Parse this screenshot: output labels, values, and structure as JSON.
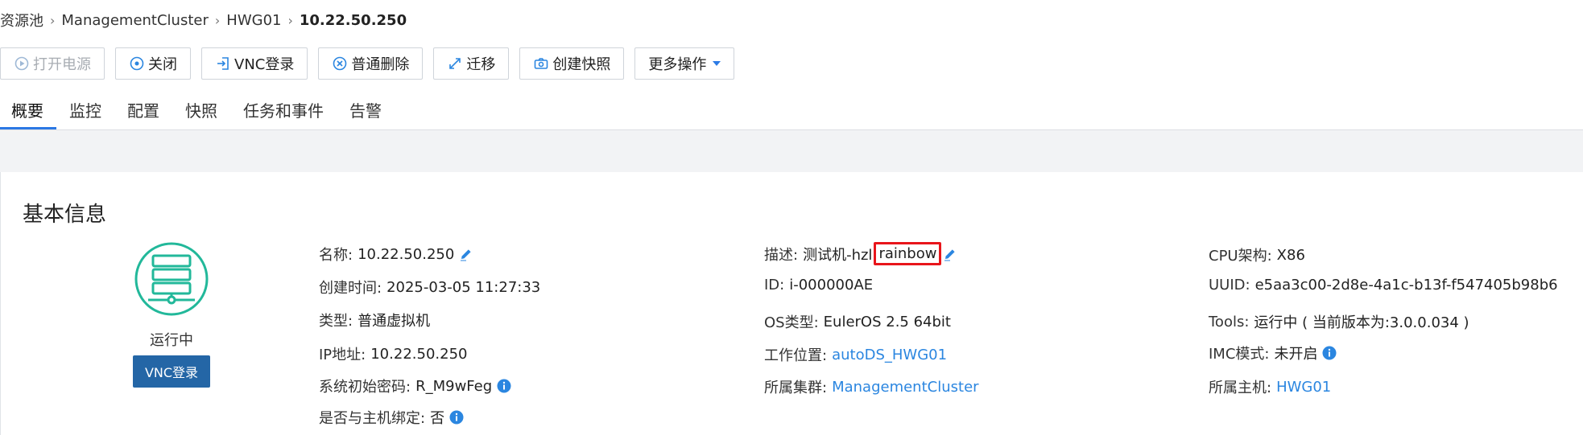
{
  "breadcrumb": {
    "items": [
      "资源池",
      "ManagementCluster",
      "HWG01"
    ],
    "current": "10.22.50.250"
  },
  "toolbar": {
    "power_on": "打开电源",
    "shutdown": "关闭",
    "vnc_login": "VNC登录",
    "delete": "普通删除",
    "migrate": "迁移",
    "snapshot": "创建快照",
    "more": "更多操作"
  },
  "tabs": [
    "概要",
    "监控",
    "配置",
    "快照",
    "任务和事件",
    "告警"
  ],
  "section": {
    "title": "基本信息"
  },
  "vm": {
    "status": "运行中",
    "vnc_button": "VNC登录"
  },
  "col1": {
    "name_label": "名称:",
    "name_value": "10.22.50.250",
    "created_label": "创建时间:",
    "created_value": "2025-03-05 11:27:33",
    "type_label": "类型:",
    "type_value": "普通虚拟机",
    "ip_label": "IP地址:",
    "ip_value": "10.22.50.250",
    "pwd_label": "系统初始密码:",
    "pwd_value": "R_M9wFeg",
    "bind_label": "是否与主机绑定:",
    "bind_value": "否"
  },
  "col2": {
    "desc_label": "描述:",
    "desc_value": "测试机-hzl",
    "desc_highlight": "rainbow",
    "id_label": "ID:",
    "id_value": "i-000000AE",
    "os_label": "OS类型:",
    "os_value": "EulerOS 2.5 64bit",
    "location_label": "工作位置:",
    "location_value": "autoDS_HWG01",
    "cluster_label": "所属集群:",
    "cluster_value": "ManagementCluster"
  },
  "col3": {
    "cpu_label": "CPU架构:",
    "cpu_value": "X86",
    "uuid_label": "UUID:",
    "uuid_value": "e5aa3c00-2d8e-4a1c-b13f-f547405b98b6",
    "tools_label": "Tools:",
    "tools_value": "运行中 ( 当前版本为:3.0.0.034 )",
    "imc_label": "IMC模式:",
    "imc_value": "未开启",
    "host_label": "所属主机:",
    "host_value": "HWG01"
  },
  "colors": {
    "accent": "#2b86e0",
    "vm_icon": "#22b89a",
    "vnc_button_bg": "#2466a6",
    "highlight_box": "#e8151b"
  }
}
